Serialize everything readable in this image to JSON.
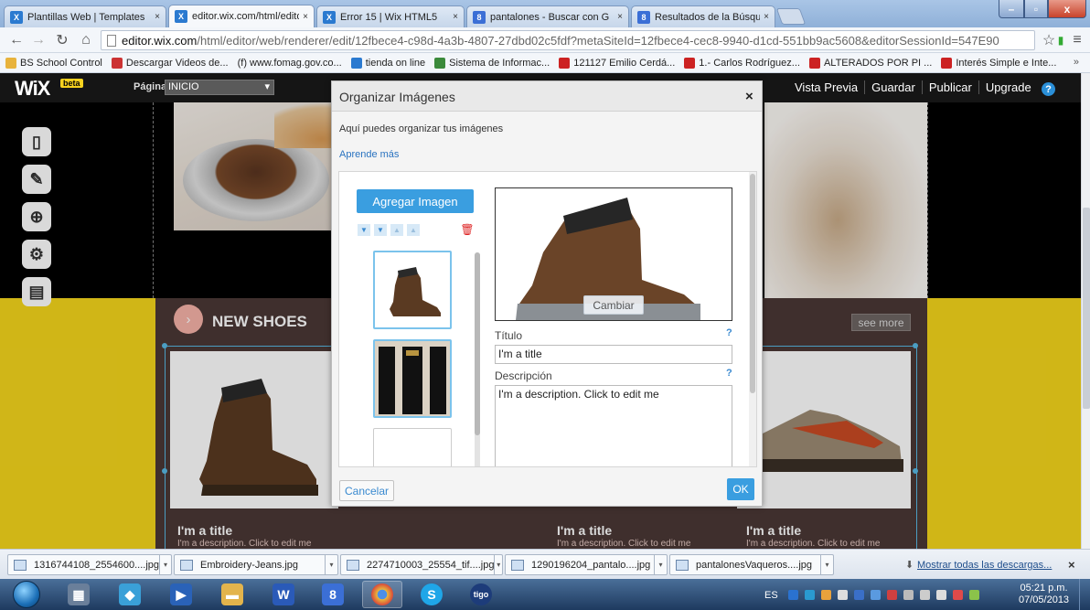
{
  "browser": {
    "tabs": [
      {
        "label": "Plantillas Web | Templates",
        "icon_color": "#2b7ad0",
        "icon_glyph": "X",
        "active": false
      },
      {
        "label": "editor.wix.com/html/edito",
        "icon_color": "#2b7ad0",
        "icon_glyph": "X",
        "active": true
      },
      {
        "label": "Error 15 | Wix HTML5",
        "icon_color": "#2b7ad0",
        "icon_glyph": "X",
        "active": false
      },
      {
        "label": "pantalones - Buscar con G",
        "icon_color": "#3b6fd6",
        "icon_glyph": "8",
        "active": false
      },
      {
        "label": "Resultados de la Búsqueda",
        "icon_color": "#3b6fd6",
        "icon_glyph": "8",
        "active": false
      }
    ],
    "url_host": "editor.wix.com",
    "url_path": "/html/editor/web/renderer/edit/12fbece4-c98d-4a3b-4807-27dbd02c5fdf?metaSiteId=12fbece4-cec8-9940-d1cd-551bb9ac5608&editorSessionId=547E90",
    "bookmarks": [
      {
        "label": "BS School Control",
        "color": "#e8b33c"
      },
      {
        "label": "Descargar Videos de...",
        "color": "#c33"
      },
      {
        "label": "(f) www.fomag.gov.co...",
        "color": "#ffffff"
      },
      {
        "label": "tienda on line",
        "color": "#2b7ad0"
      },
      {
        "label": "Sistema de Informac...",
        "color": "#3b8a3b"
      },
      {
        "label": "121127 Emilio Cerdá...",
        "color": "#cc2222"
      },
      {
        "label": "1.- Carlos Rodríguez...",
        "color": "#cc2222"
      },
      {
        "label": "ALTERADOS POR PI ...",
        "color": "#cc2222"
      },
      {
        "label": "Interés Simple e Inte...",
        "color": "#cc2222"
      }
    ],
    "bookmarks_more": "»"
  },
  "wix": {
    "logo": "WiX",
    "beta": "beta",
    "page_label": "Página",
    "page_value": "INICIO",
    "menu": [
      "Vista Previa",
      "Guardar",
      "Publicar",
      "Upgrade"
    ],
    "help": "?",
    "section_title": "NEW SHOES",
    "see_more": "see more",
    "cards": [
      {
        "title": "I'm a title",
        "desc": "I'm a description. Click to edit me"
      },
      {
        "title": "I'm a title",
        "desc": "I'm a description. Click to edit me"
      },
      {
        "title": "I'm a title",
        "desc": "I'm a description. Click to edit me"
      }
    ]
  },
  "modal": {
    "title": "Organizar Imágenes",
    "close": "×",
    "subtitle": "Aquí puedes organizar tus imágenes",
    "learn_more": "Aprende más",
    "add_image": "Agregar Imagen",
    "change": "Cambiar",
    "title_label": "Título",
    "title_value": "I'm a title",
    "description_label": "Descripción",
    "description_value": "I'm a description. Click to edit me",
    "help": "?",
    "cancel": "Cancelar",
    "ok": "OK"
  },
  "downloads": {
    "items": [
      "1316744108_2554600....jpg",
      "Embroidery-Jeans.jpg",
      "2274710003_25554_tif....jpg",
      "1290196204_pantalo....jpg",
      "pantalonesVaqueros....jpg"
    ],
    "show_all": "Mostrar todas las descargas...",
    "close": "×"
  },
  "taskbar": {
    "lang": "ES",
    "time": "05:21 p.m.",
    "date": "07/05/2013"
  }
}
